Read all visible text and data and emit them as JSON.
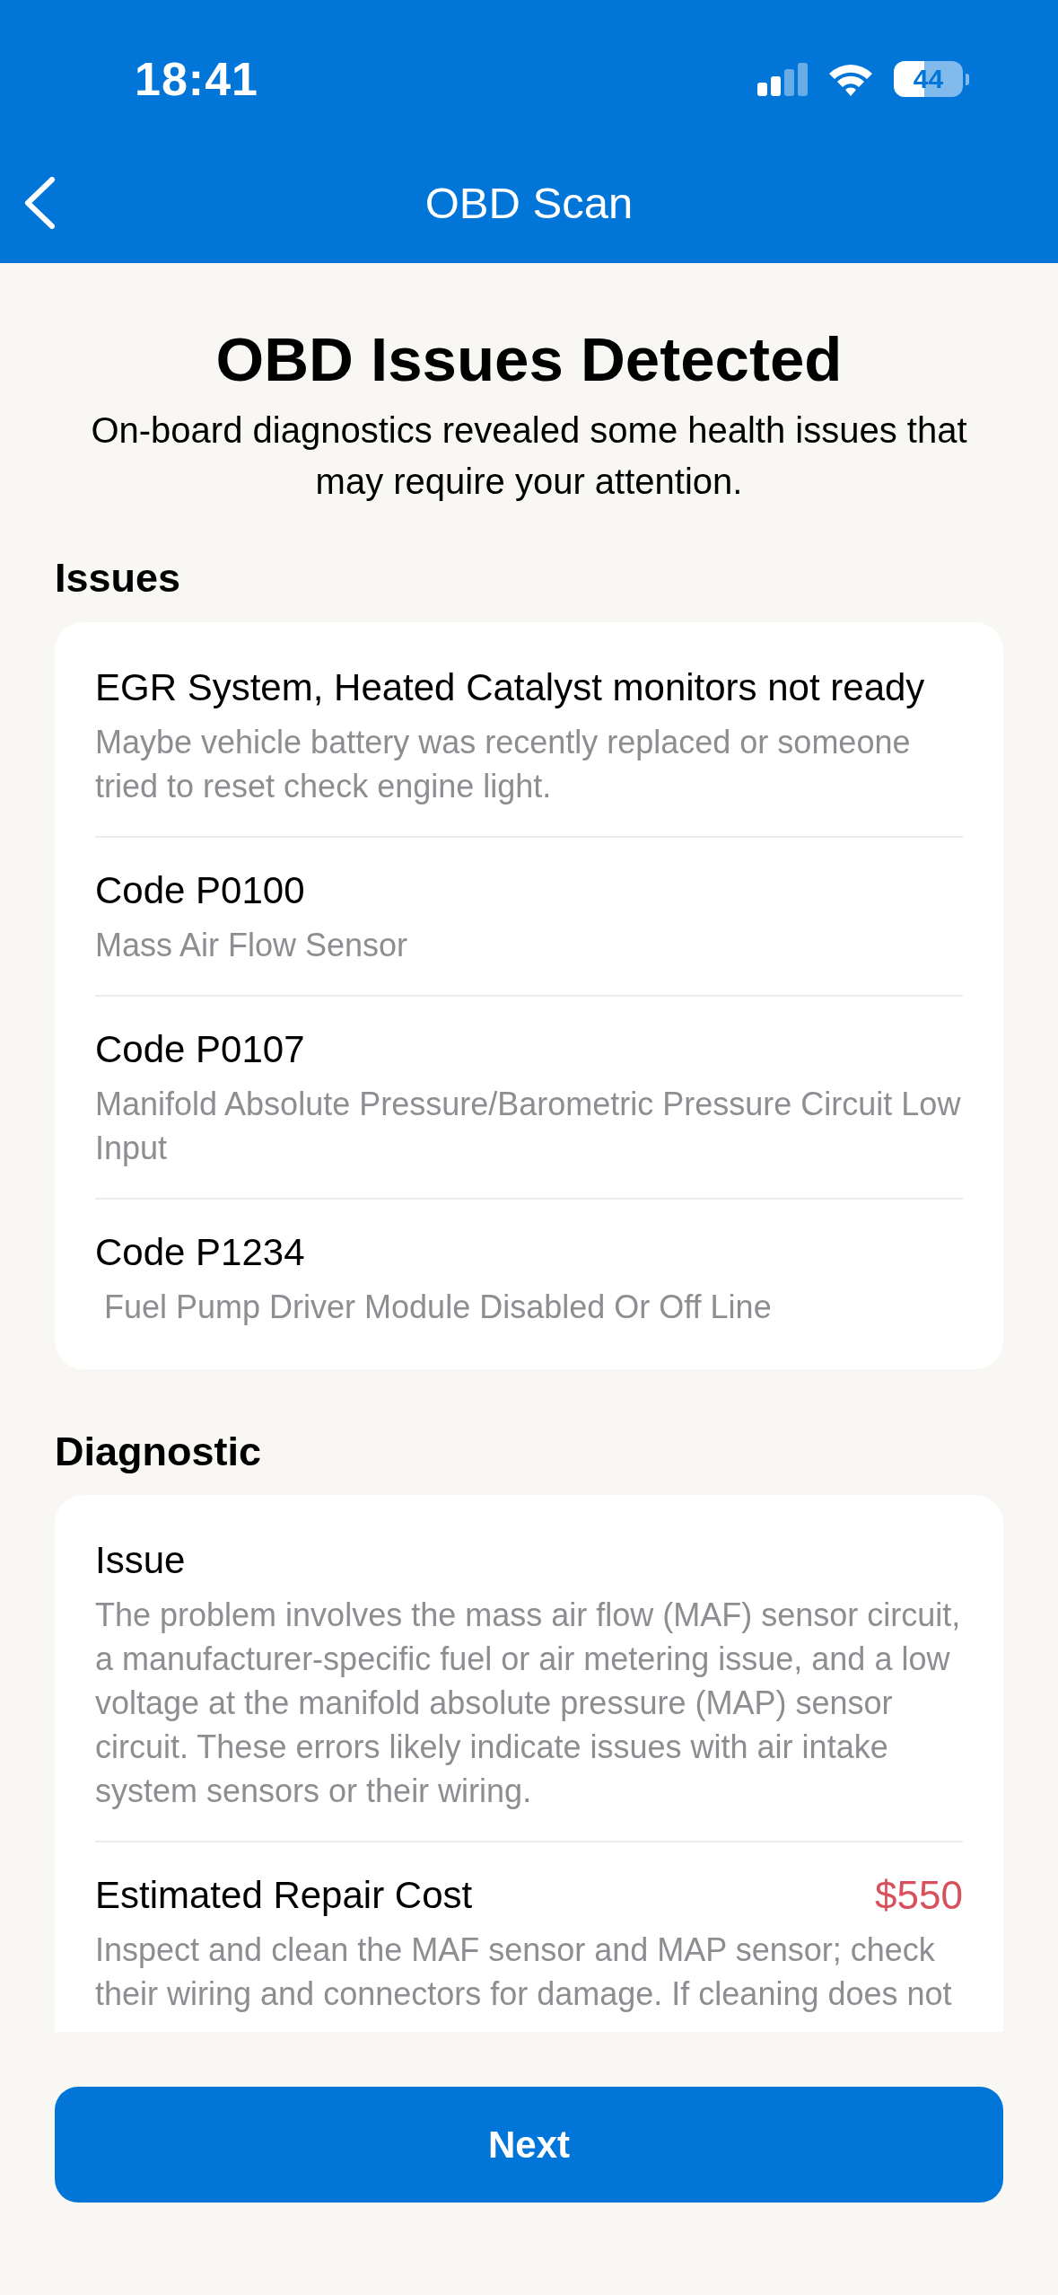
{
  "status_bar": {
    "time": "18:41",
    "battery": "44"
  },
  "nav_bar": {
    "title": "OBD Scan"
  },
  "header": {
    "title": "OBD Issues Detected",
    "subtitle": "On-board diagnostics revealed some health issues that may require your attention."
  },
  "issues": {
    "heading": "Issues",
    "items": [
      {
        "title": "EGR System, Heated Catalyst monitors not ready",
        "description": "Maybe vehicle battery was recently replaced or someone tried to reset check engine light."
      },
      {
        "title": "Code P0100",
        "description": "Mass Air Flow Sensor"
      },
      {
        "title": "Code P0107",
        "description": "Manifold Absolute Pressure/Barometric Pressure Circuit Low Input"
      },
      {
        "title": "Code P1234",
        "description": " Fuel Pump Driver Module Disabled Or Off Line"
      }
    ]
  },
  "diagnostic": {
    "heading": "Diagnostic",
    "items": [
      {
        "title": "Issue",
        "description": "The problem involves the mass air flow (MAF) sensor circuit, a manufacturer-specific fuel or air metering issue, and a low voltage at the manifold absolute pressure (MAP) sensor circuit. These errors likely indicate issues with air intake system sensors or their wiring."
      },
      {
        "title": "Estimated Repair Cost",
        "value": "$550",
        "description": "Inspect and clean the MAF sensor and MAP sensor; check their wiring and connectors for damage. If cleaning does not"
      }
    ]
  },
  "next_button": {
    "label": "Next"
  }
}
